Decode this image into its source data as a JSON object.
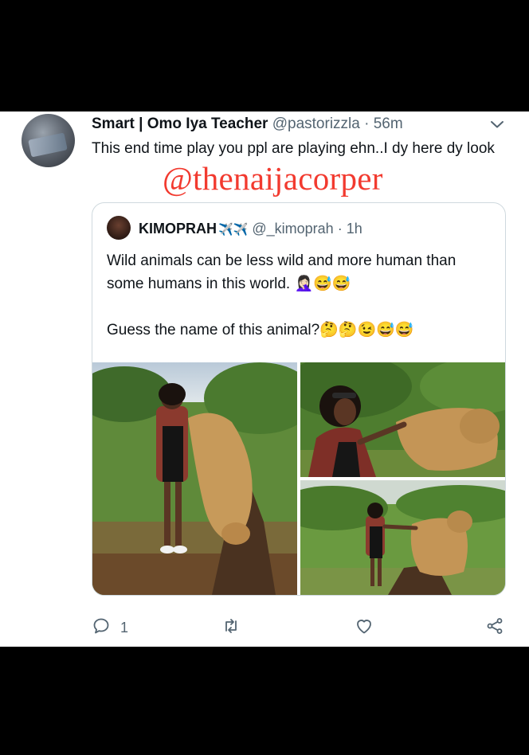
{
  "tweet": {
    "author_name": "Smart | Omo Iya Teacher",
    "author_handle": "@pastorizzla",
    "separator": "·",
    "time": "56m",
    "text": "This end time play you ppl are playing ehn..I dy here dy look"
  },
  "watermark": "@thenaijacorper",
  "quoted_tweet": {
    "author_name": "KIMOPRAH",
    "name_emoji": "✈️✈️",
    "author_handle": "@_kimoprah",
    "separator": "·",
    "time": "1h",
    "line1": "Wild animals can be less wild and more human than some humans in this world. 🤦🏻‍♀️😅😅",
    "line2": "Guess the name of this animal?🤔🤔😉😅😅"
  },
  "actions": {
    "reply_count": "1",
    "icons": [
      "reply-icon",
      "retweet-icon",
      "like-icon",
      "share-icon"
    ]
  },
  "colors": {
    "background": "#000000",
    "card": "#ffffff",
    "text": "#0f1419",
    "muted": "#536471",
    "watermark": "#f23a2f",
    "border": "#cfd9de"
  }
}
